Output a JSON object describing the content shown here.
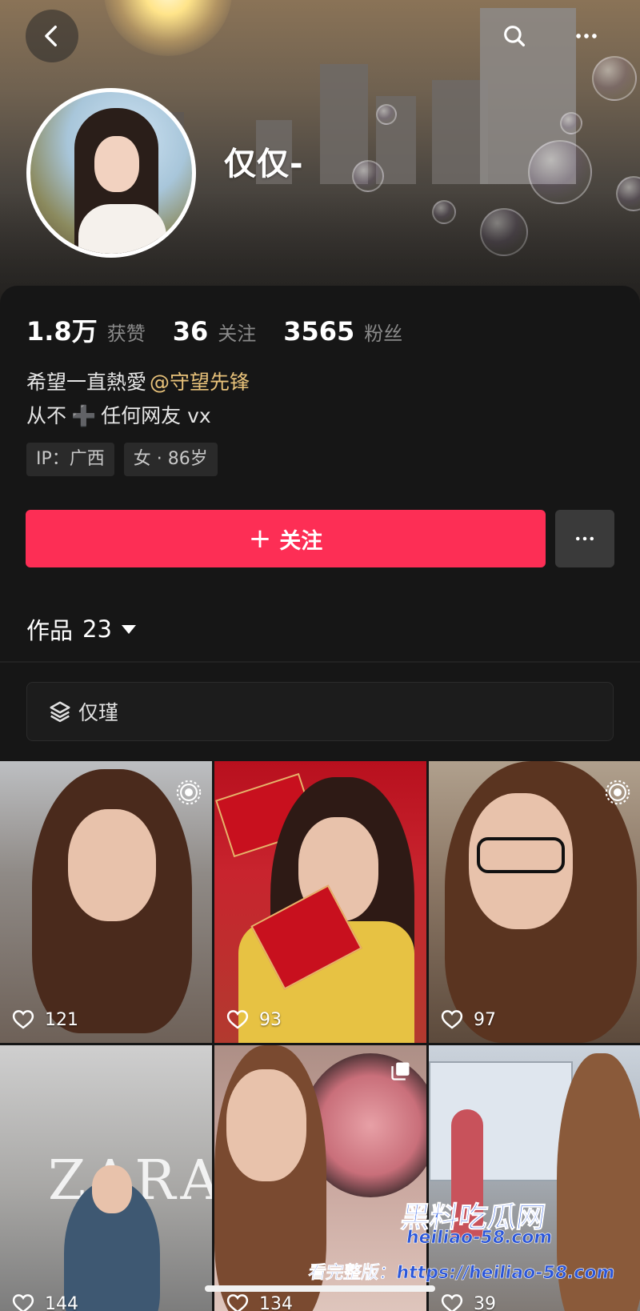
{
  "profile": {
    "nickname": "仅仅-",
    "stats": [
      {
        "value": "1.8万",
        "label": "获赞"
      },
      {
        "value": "36",
        "label": "关注"
      },
      {
        "value": "3565",
        "label": "粉丝"
      }
    ],
    "bio_line1": "希望一直熱愛",
    "bio_mention": "@守望先锋",
    "bio_line2_a": "从不",
    "bio_line2_emoji": "➕",
    "bio_line2_b": "任何网友 vx",
    "tags": [
      "IP：广西",
      "女 · 86岁"
    ]
  },
  "actions": {
    "follow_plus": "+",
    "follow_label": "关注",
    "more_icon": "ellipsis-icon"
  },
  "works": {
    "label": "作品",
    "count": "23"
  },
  "collection": {
    "name": "仅瑾",
    "icon": "layers-icon"
  },
  "videos": [
    {
      "likes": "121",
      "badge": "live-photo-icon"
    },
    {
      "likes": "93",
      "badge": ""
    },
    {
      "likes": "97",
      "badge": "live-photo-icon"
    },
    {
      "likes": "144",
      "badge": "",
      "sign_text": "ZARA"
    },
    {
      "likes": "134",
      "badge": "multi-image-icon"
    },
    {
      "likes": "39",
      "badge": ""
    }
  ],
  "watermark": {
    "line1": "黑料吃瓜网",
    "line2": "heiliao-58.com",
    "line3": "看完整版：https://heiliao-58.com"
  },
  "colors": {
    "accent": "#fd2e55",
    "mention": "#e8c27a",
    "background": "#161616"
  }
}
